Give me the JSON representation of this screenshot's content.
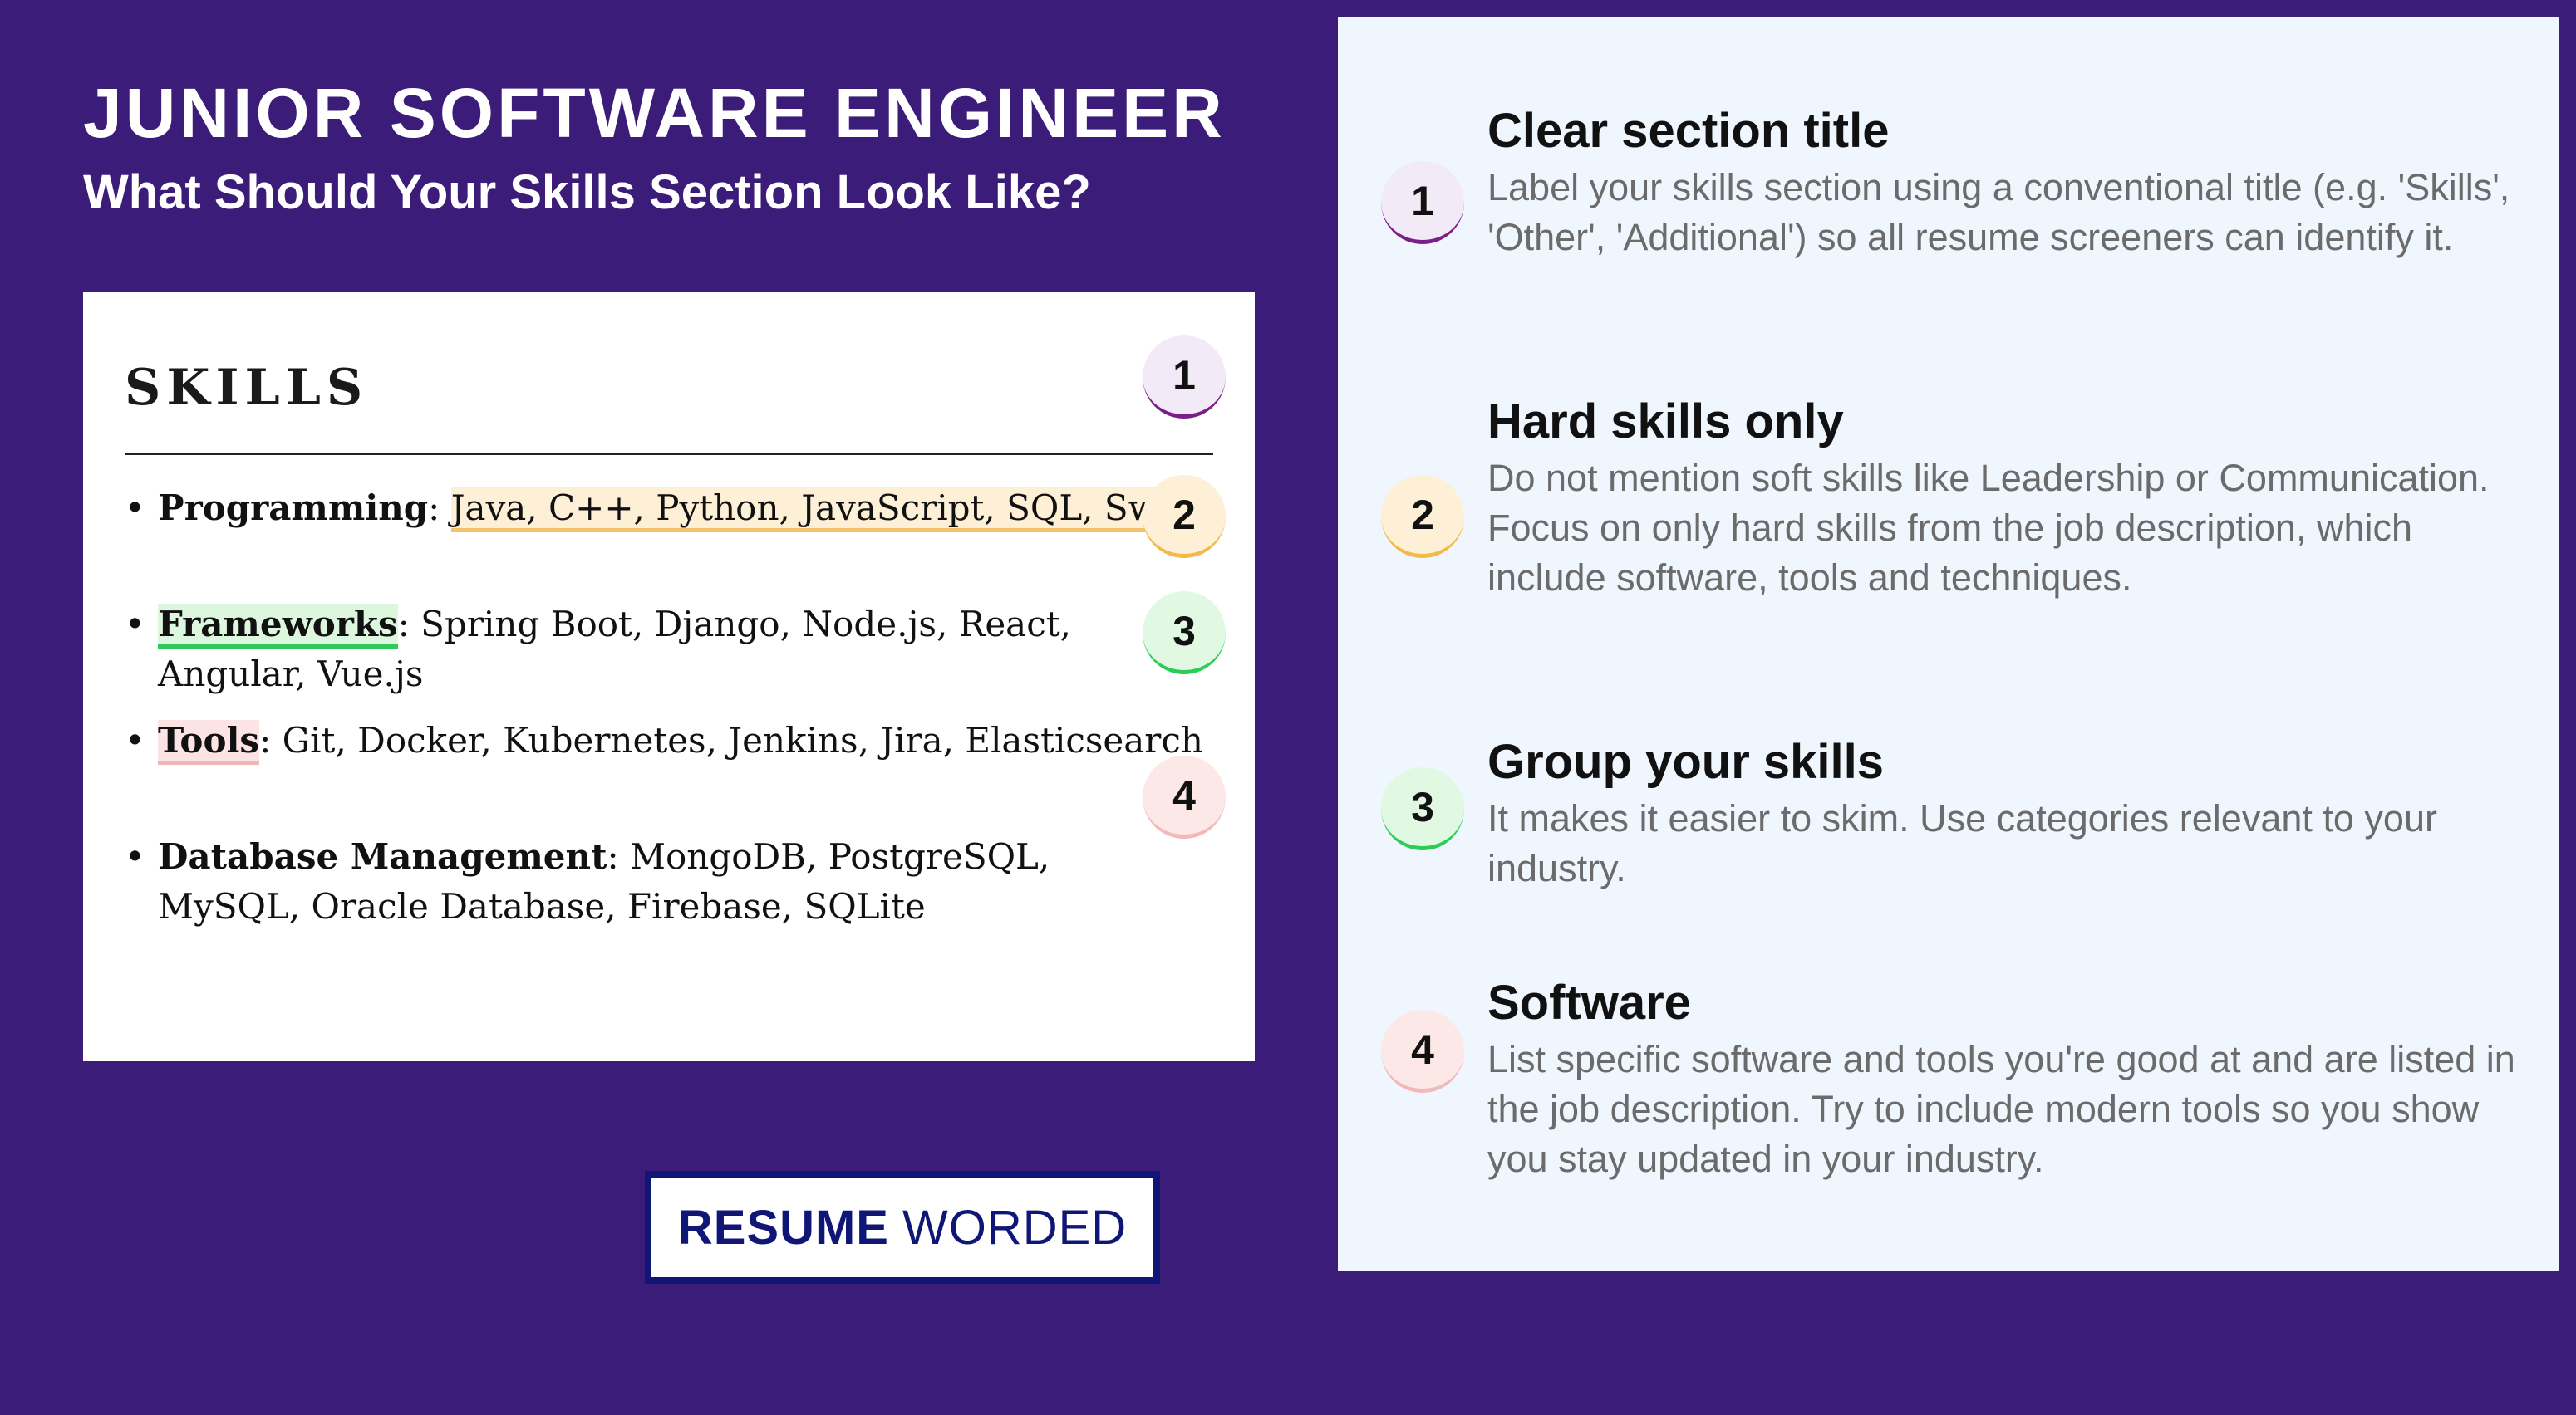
{
  "header": {
    "title": "JUNIOR SOFTWARE ENGINEER",
    "subtitle_pre": "What Should Your ",
    "subtitle_bold": "Skills",
    "subtitle_post": " Section Look Like?"
  },
  "resume": {
    "heading": "SKILLS",
    "skills": [
      {
        "name": "Programming",
        "sep": ": ",
        "value": "Java, C++, Python, JavaScript, SQL, Swift",
        "badge": "2"
      },
      {
        "name": "Frameworks",
        "sep": ": ",
        "value": "Spring Boot, Django, Node.js, React, Angular, Vue.js",
        "badge": "3"
      },
      {
        "name": "Tools",
        "sep": ": ",
        "value": "Git, Docker, Kubernetes, Jenkins, Jira, Elasticsearch",
        "badge": "4"
      },
      {
        "name": "Database Management",
        "sep": ": ",
        "value": "MongoDB, PostgreSQL, MySQL, Oracle Database, Firebase, SQLite"
      }
    ],
    "heading_badge": "1"
  },
  "logo": {
    "bold": "RESUME",
    "light": "WORDED"
  },
  "tips": [
    {
      "number": "1",
      "title": "Clear section title",
      "body": "Label your skills section using a conventional title (e.g. 'Skills', 'Other', 'Additional') so all resume screeners can identify it."
    },
    {
      "number": "2",
      "title": "Hard skills only",
      "body": "Do not mention soft skills like Leadership or Communication. Focus on only hard skills from the job description, which include software, tools and techniques."
    },
    {
      "number": "3",
      "title": "Group your skills",
      "body": "It makes it easier to skim. Use categories relevant to your industry."
    },
    {
      "number": "4",
      "title": "Software",
      "body": "List specific software and tools you're good at and are listed in the job description. Try to include modern tools so you show you stay updated in your industry."
    }
  ],
  "colors": {
    "background": "#3b1c78",
    "panel": "#eff6fe",
    "badge_1": "#7a1f86",
    "badge_2": "#f2b94b",
    "badge_3": "#2dcc56",
    "badge_4": "#f5b8b8",
    "logo": "#0f1675"
  }
}
